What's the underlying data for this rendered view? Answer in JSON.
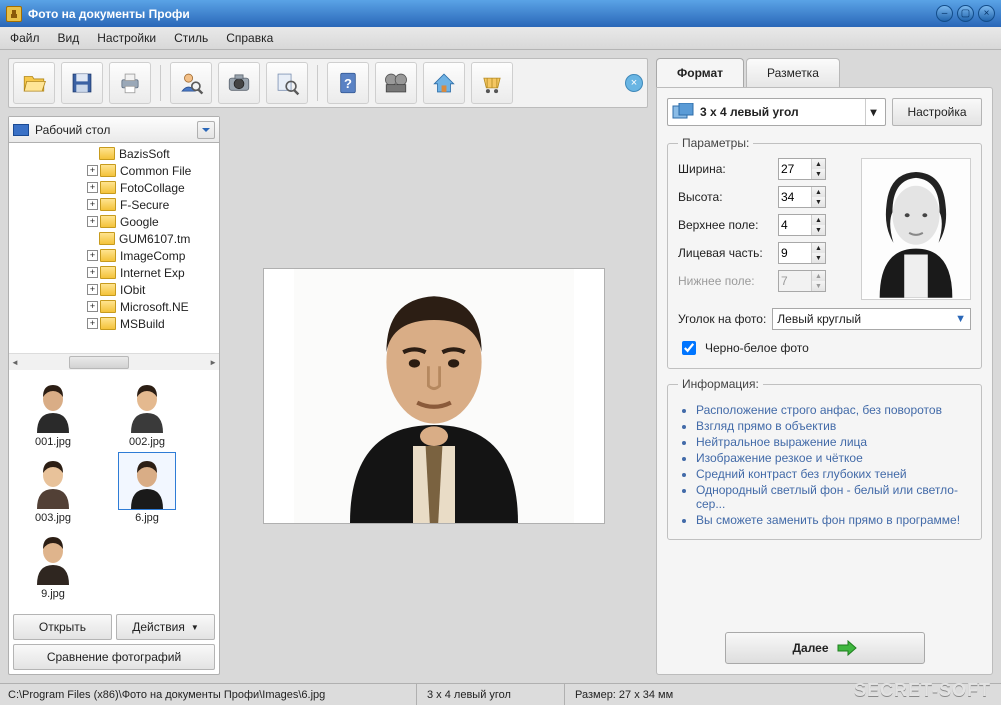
{
  "titlebar": {
    "title": "Фото на документы Профи"
  },
  "menubar": [
    "Файл",
    "Вид",
    "Настройки",
    "Стиль",
    "Справка"
  ],
  "toolbar_icons": [
    "open-icon",
    "save-icon",
    "print-icon",
    "",
    "user-search-icon",
    "camera-icon",
    "view-icon",
    "",
    "help-icon",
    "video-icon",
    "home-icon",
    "cart-icon"
  ],
  "browser": {
    "location": "Рабочий стол",
    "folders": [
      {
        "name": "BazisSoft",
        "plus": false
      },
      {
        "name": "Common File",
        "plus": true
      },
      {
        "name": "FotoCollage",
        "plus": true
      },
      {
        "name": "F-Secure",
        "plus": true
      },
      {
        "name": "Google",
        "plus": true
      },
      {
        "name": "GUM6107.tm",
        "plus": false
      },
      {
        "name": "ImageComp",
        "plus": true
      },
      {
        "name": "Internet Exp",
        "plus": true
      },
      {
        "name": "IObit",
        "plus": true
      },
      {
        "name": "Microsoft.NE",
        "plus": true
      },
      {
        "name": "MSBuild",
        "plus": true
      }
    ],
    "thumbs": [
      {
        "name": "001.jpg",
        "sel": false
      },
      {
        "name": "002.jpg",
        "sel": false
      },
      {
        "name": "003.jpg",
        "sel": false
      },
      {
        "name": "6.jpg",
        "sel": true
      },
      {
        "name": "9.jpg",
        "sel": false
      }
    ],
    "open_btn": "Открыть",
    "actions_btn": "Действия",
    "compare_btn": "Сравнение фотографий"
  },
  "tabs": {
    "t1": "Формат",
    "t2": "Разметка"
  },
  "format": {
    "combo": "3 x 4 левый угол",
    "settings_btn": "Настройка",
    "params_legend": "Параметры:",
    "width_l": "Ширина:",
    "width_v": "27",
    "height_l": "Высота:",
    "height_v": "34",
    "top_l": "Верхнее поле:",
    "top_v": "4",
    "face_l": "Лицевая часть:",
    "face_v": "9",
    "bottom_l": "Нижнее поле:",
    "bottom_v": "7",
    "corner_l": "Уголок на фото:",
    "corner_v": "Левый круглый",
    "bw_l": "Черно-белое фото",
    "info_legend": "Информация:",
    "info": [
      "Расположение строго анфас, без поворотов",
      "Взгляд прямо в объектив",
      "Нейтральное выражение лица",
      "Изображение резкое и чёткое",
      "Средний контраст без глубоких теней",
      "Однородный светлый фон - белый или светло-сер...",
      "Вы сможете заменить фон прямо в программе!"
    ],
    "next": "Далее"
  },
  "status": {
    "path": "C:\\Program Files (x86)\\Фото на документы Профи\\Images\\6.jpg",
    "format": "3 x 4 левый угол",
    "size": "Размер: 27 x 34 мм"
  },
  "watermark": "SECRET-SOFT"
}
